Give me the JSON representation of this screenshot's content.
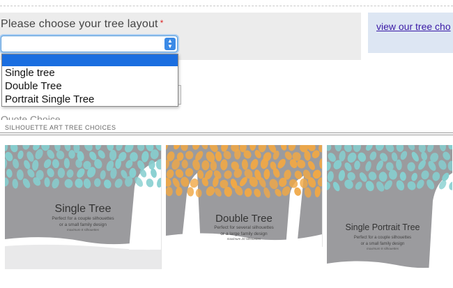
{
  "form": {
    "label": "Please choose your tree layout",
    "required_mark": "*",
    "select_value": "",
    "dropdown_options": [
      "",
      "Single tree",
      "Double Tree",
      "Portrait Single Tree"
    ],
    "hidden_label": "Quote Choice"
  },
  "info": {
    "link_text": "view our tree cho"
  },
  "section": {
    "title": "SILHOUETTE ART TREE CHOICES",
    "cards": [
      {
        "title": "Single Tree",
        "line1": "Perfect for a couple silhouettes",
        "line2": "or a small family design",
        "line3": "maximum 8 silhouettes",
        "leaf_color": "#86cfd0"
      },
      {
        "title": "Double Tree",
        "line1": "Perfect for several silhouettes",
        "line2": "or a large family design",
        "line3": "maximum 20 silhouettes",
        "leaf_color": "#f0a846"
      },
      {
        "title": "Single Portrait Tree",
        "line1": "Perfect for a couple silhouettes",
        "line2": "or a small family design",
        "line3": "maximum 8 silhouettes",
        "leaf_color": "#86cfd0"
      }
    ]
  },
  "colors": {
    "panel_bg": "#ececec",
    "info_bg": "#dde6f3",
    "select_accent": "#3b8ae6",
    "option_highlight": "#1a6ee0",
    "card_gray": "#9b9b9e"
  }
}
